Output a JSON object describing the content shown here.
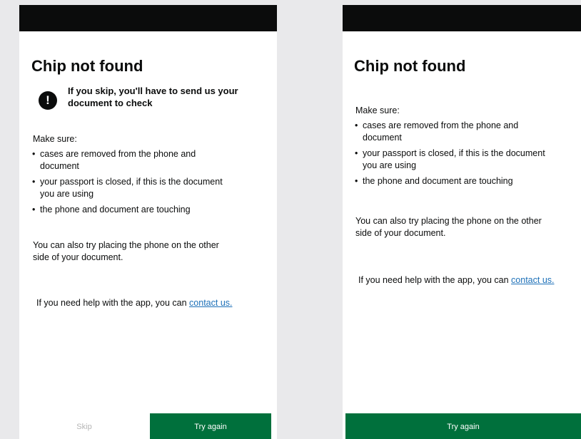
{
  "left": {
    "title": "Chip not found",
    "warning": "If you skip, you'll have to send us your document to check",
    "warning_icon": "!",
    "make_sure": "Make sure:",
    "bullets": [
      [
        "cases are removed from the phone and",
        "document"
      ],
      [
        "your passport is closed, if this is the document",
        "you are using"
      ],
      [
        "the phone and document are touching",
        ""
      ]
    ],
    "other_side_1": "You can also try placing the phone on the other",
    "other_side_2": "side of your document.",
    "help_prefix": "If you need help with the app, you can ",
    "help_link": "contact us.",
    "skip_label": "Skip",
    "try_again_label": "Try again"
  },
  "right": {
    "title": "Chip not found",
    "make_sure": "Make sure:",
    "bullets": [
      [
        "cases are removed from the phone and",
        "document"
      ],
      [
        "your passport is closed, if this is the document",
        "you are using"
      ],
      [
        "the phone and document are touching",
        ""
      ]
    ],
    "other_side_1": "You can also try placing the phone on the other",
    "other_side_2": "side of your document.",
    "help_prefix": "If you need help with the app, you can ",
    "help_link": "contact us.",
    "try_again_label": "Try again"
  },
  "colors": {
    "primary_button": "#00703c",
    "link": "#1d70b8",
    "status_bar": "#0b0c0c"
  }
}
